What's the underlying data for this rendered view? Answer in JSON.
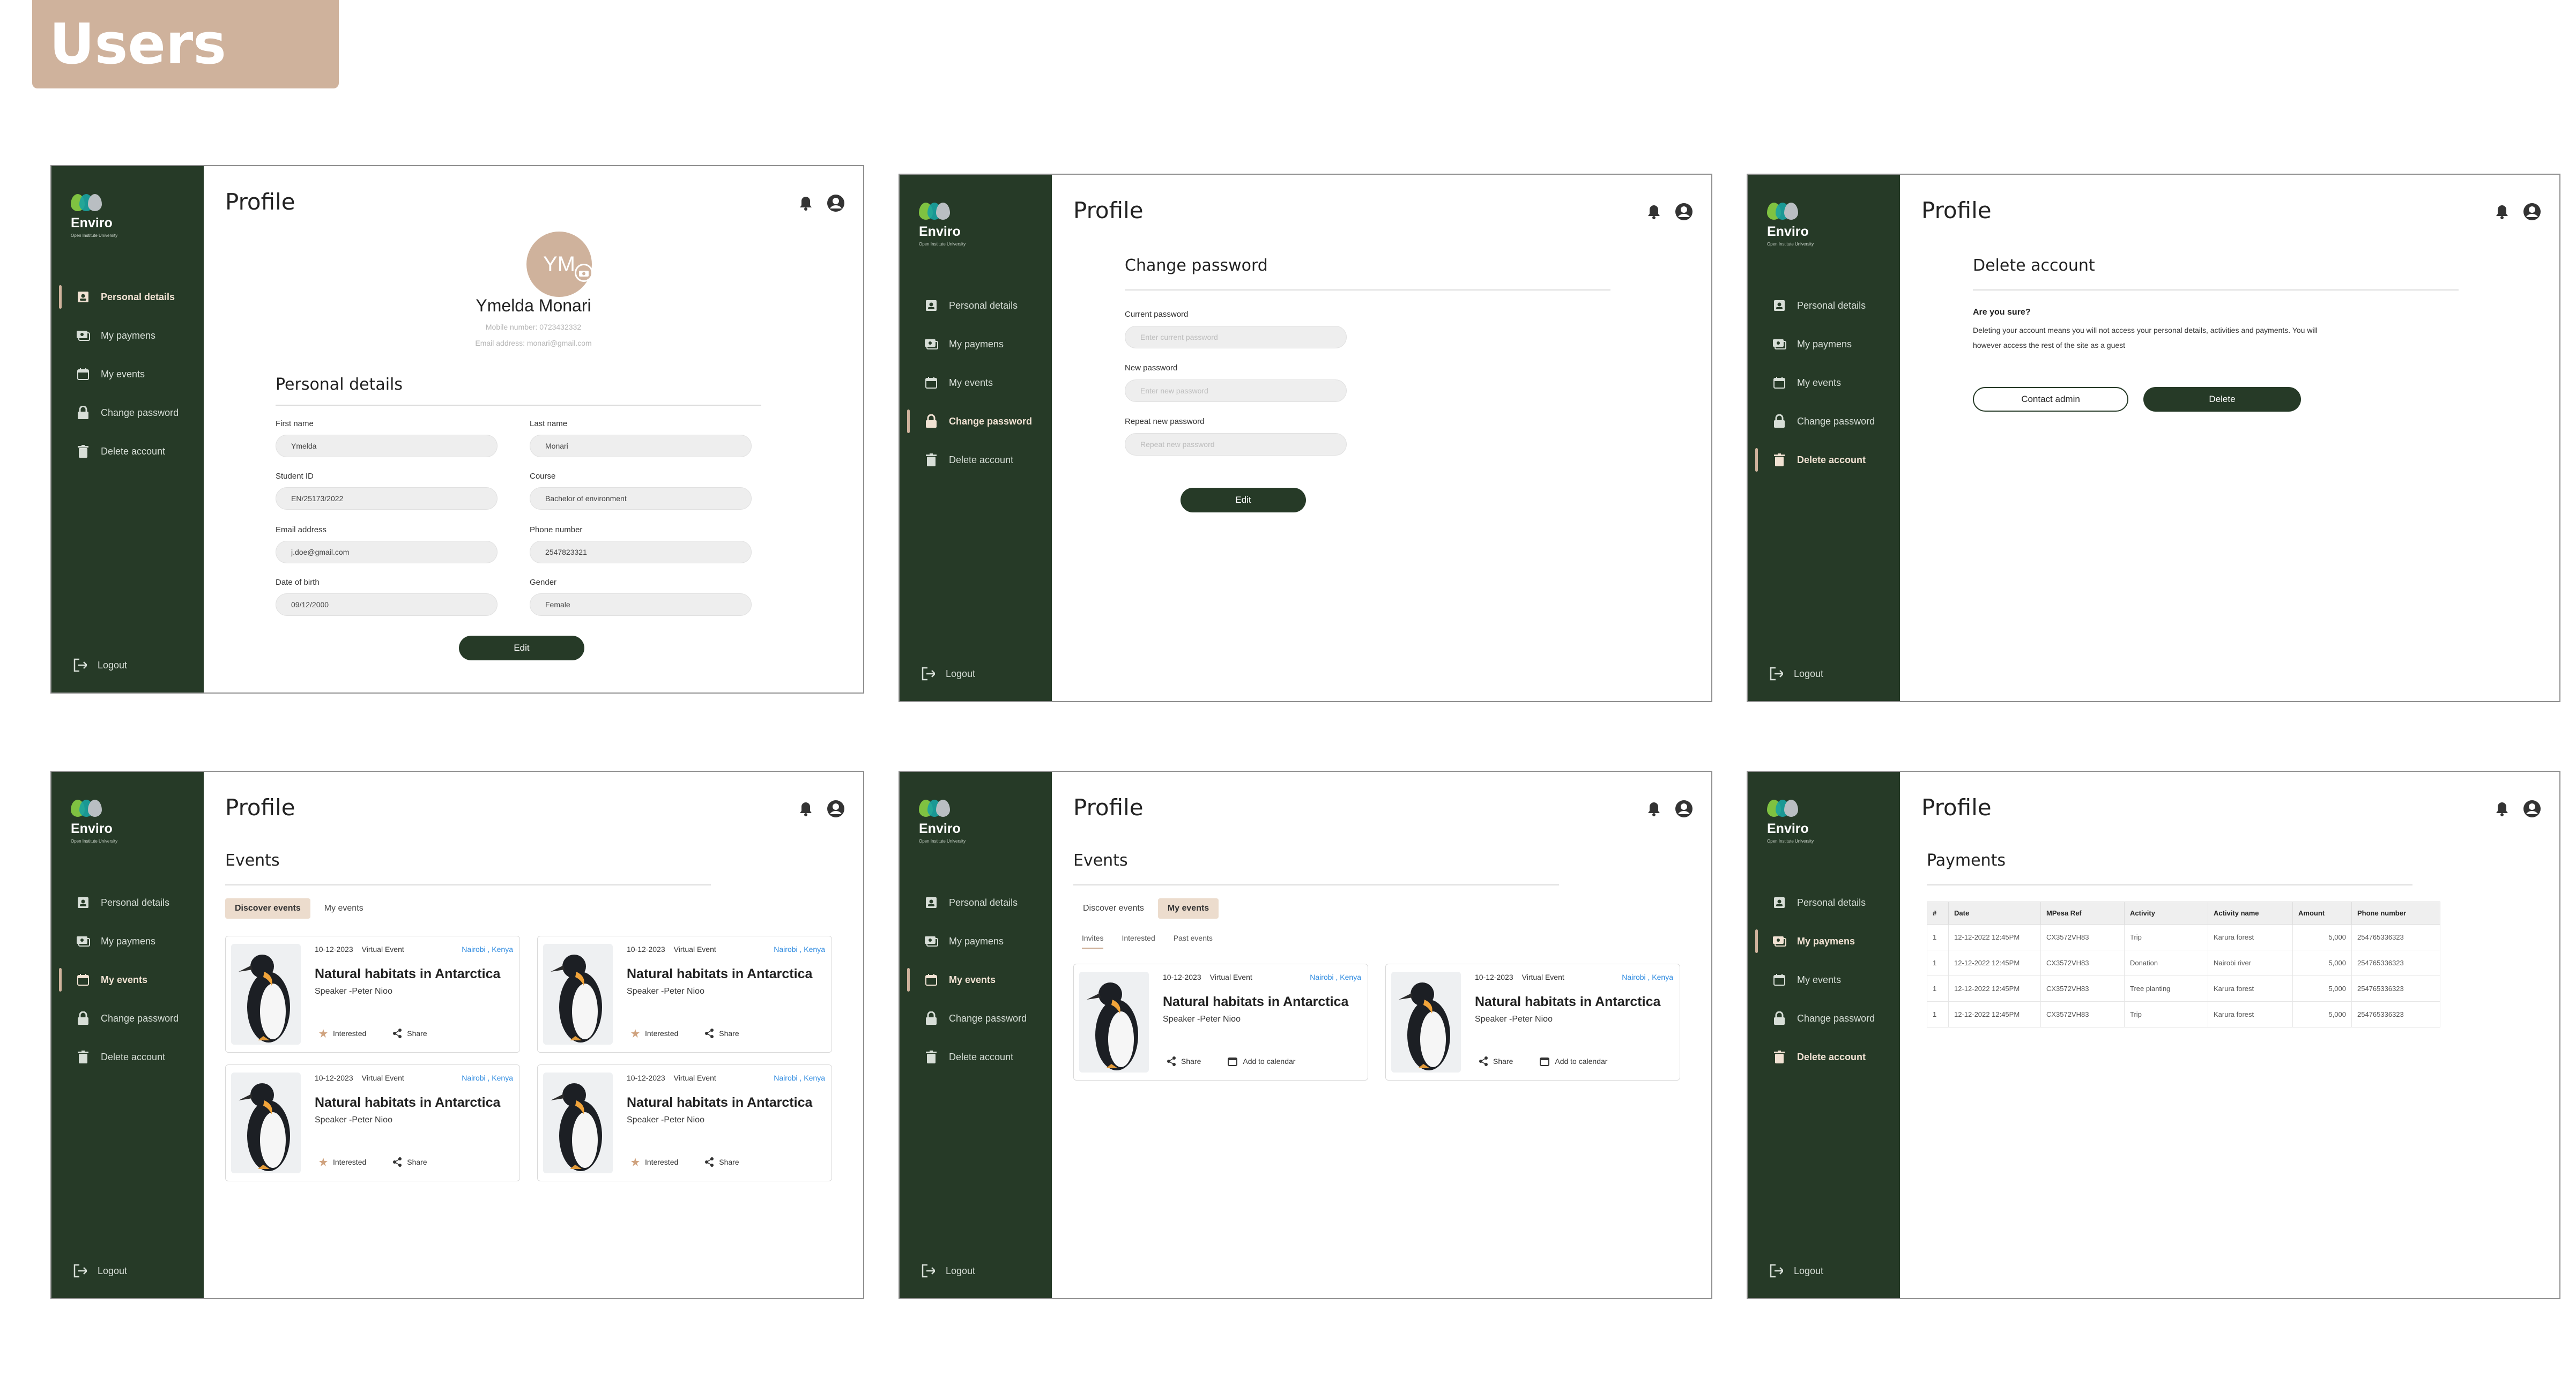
{
  "page_label": "Users",
  "app": {
    "brand": "Enviro",
    "brand_sub": "Open Institute University",
    "header_title": "Profile",
    "nav": [
      "Personal details",
      "My paymens",
      "My events",
      "Change password",
      "Delete account"
    ],
    "logout": "Logout"
  },
  "profile": {
    "initials": "YM",
    "name": "Ymelda Monari",
    "mobile": "Mobile number: 0723432332",
    "email": "Email address: monari@gmail.com",
    "section": "Personal details",
    "fields": [
      {
        "label": "First name",
        "value": "Ymelda"
      },
      {
        "label": "Last name",
        "value": "Monari"
      },
      {
        "label": "Student ID",
        "value": "EN/25173/2022"
      },
      {
        "label": "Course",
        "value": "Bachelor of environment"
      },
      {
        "label": "Email address",
        "value": "j.doe@gmail.com"
      },
      {
        "label": "Phone number",
        "value": "2547823321"
      },
      {
        "label": "Date of birth",
        "value": "09/12/2000"
      },
      {
        "label": "Gender",
        "value": "Female"
      }
    ],
    "edit": "Edit"
  },
  "change_password": {
    "section": "Change password",
    "fields": [
      {
        "label": "Current password",
        "placeholder": "Enter current password"
      },
      {
        "label": "New password",
        "placeholder": "Enter new password"
      },
      {
        "label": "Repeat new password",
        "placeholder": "Repeat new password"
      }
    ],
    "edit": "Edit"
  },
  "delete_account": {
    "section": "Delete account",
    "question": "Are you sure?",
    "text_line1": "Deleting your account means you will not access your personal details, activities and payments. You will",
    "text_line2": "however access the rest of the site as a guest",
    "contact": "Contact admin",
    "delete": "Delete"
  },
  "events": {
    "section": "Events",
    "tab_discover": "Discover events",
    "tab_my": "My events",
    "subtabs": [
      "Invites",
      "Interested",
      "Past events"
    ],
    "card": {
      "date": "10-12-2023",
      "type": "Virtual Event",
      "location": "Nairobi , Kenya",
      "title": "Natural habitats in Antarctica",
      "speaker": "Speaker -Peter Nioo",
      "interested": "Interested",
      "share": "Share",
      "calendar": "Add to calendar"
    }
  },
  "payments": {
    "section": "Payments",
    "headers": [
      "#",
      "Date",
      "MPesa Ref",
      "Activity",
      "Activity name",
      "Amount",
      "Phone number"
    ],
    "rows": [
      [
        "1",
        "12-12-2022 12:45PM",
        "CX3572VH83",
        "Trip",
        "Karura forest",
        "5,000",
        "254765336323"
      ],
      [
        "1",
        "12-12-2022 12:45PM",
        "CX3572VH83",
        "Donation",
        "Nairobi river",
        "5,000",
        "254765336323"
      ],
      [
        "1",
        "12-12-2022 12:45PM",
        "CX3572VH83",
        "Tree planting",
        "Karura forest",
        "5,000",
        "254765336323"
      ],
      [
        "1",
        "12-12-2022 12:45PM",
        "CX3572VH83",
        "Trip",
        "Karura forest",
        "5,000",
        "254765336323"
      ]
    ]
  },
  "colors": {
    "sidebar": "#263a27",
    "accent": "#cfb29c",
    "link": "#2f8be0"
  }
}
